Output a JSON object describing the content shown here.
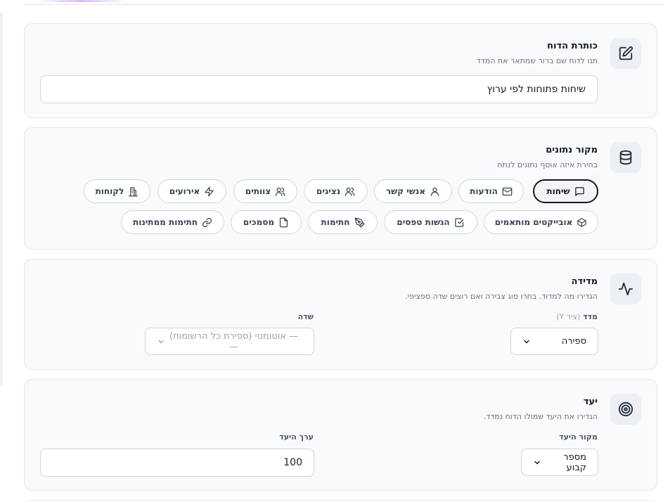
{
  "report_title_section": {
    "title": "כותרת הדוח",
    "subtitle": "תנו לדוח שם ברור שמתאר את המדד",
    "value": "שיחות פתוחות לפי ערוץ",
    "icon": "edit-icon"
  },
  "data_source_section": {
    "title": "מקור נתונים",
    "subtitle": "בחירת איזה אוסף נתונים לנתח",
    "icon": "database-icon",
    "sources": [
      {
        "label": "שיחות",
        "icon": "message-square-icon",
        "active": true
      },
      {
        "label": "הודעות",
        "icon": "mail-icon",
        "active": false
      },
      {
        "label": "אנשי קשר",
        "icon": "user-icon",
        "active": false
      },
      {
        "label": "נציגים",
        "icon": "users-icon",
        "active": false
      },
      {
        "label": "צוותים",
        "icon": "users-icon",
        "active": false
      },
      {
        "label": "אירועים",
        "icon": "zap-icon",
        "active": false
      },
      {
        "label": "לקוחות",
        "icon": "building-icon",
        "active": false
      },
      {
        "label": "אובייקטים מותאמים",
        "icon": "box-icon",
        "active": false
      },
      {
        "label": "הגשות טפסים",
        "icon": "check-square-icon",
        "active": false
      },
      {
        "label": "חתימות",
        "icon": "pen-tool-icon",
        "active": false
      },
      {
        "label": "מסמכים",
        "icon": "file-icon",
        "active": false
      },
      {
        "label": "חתימות ממתינות",
        "icon": "link-icon",
        "active": false
      }
    ]
  },
  "measure_section": {
    "title": "מדידה",
    "subtitle": "הגדירו מה למדוד. בחרו סוג צבירה ואם רוצים שדה ספציפי.",
    "icon": "activity-icon",
    "metric_label": "מדד",
    "metric_hint": "(ציר Y)",
    "metric_value": "ספירה",
    "field_label": "שדה",
    "field_value": "— אוטומטי (ספירת כל הרשומות) —"
  },
  "target_section": {
    "title": "יעד",
    "subtitle": "הגדירו את היעד שמולו הדוח נמדד.",
    "icon": "target-icon",
    "source_label": "מקור היעד",
    "source_value": "מספר קבוע",
    "value_label": "ערך היעד",
    "value": "100"
  }
}
